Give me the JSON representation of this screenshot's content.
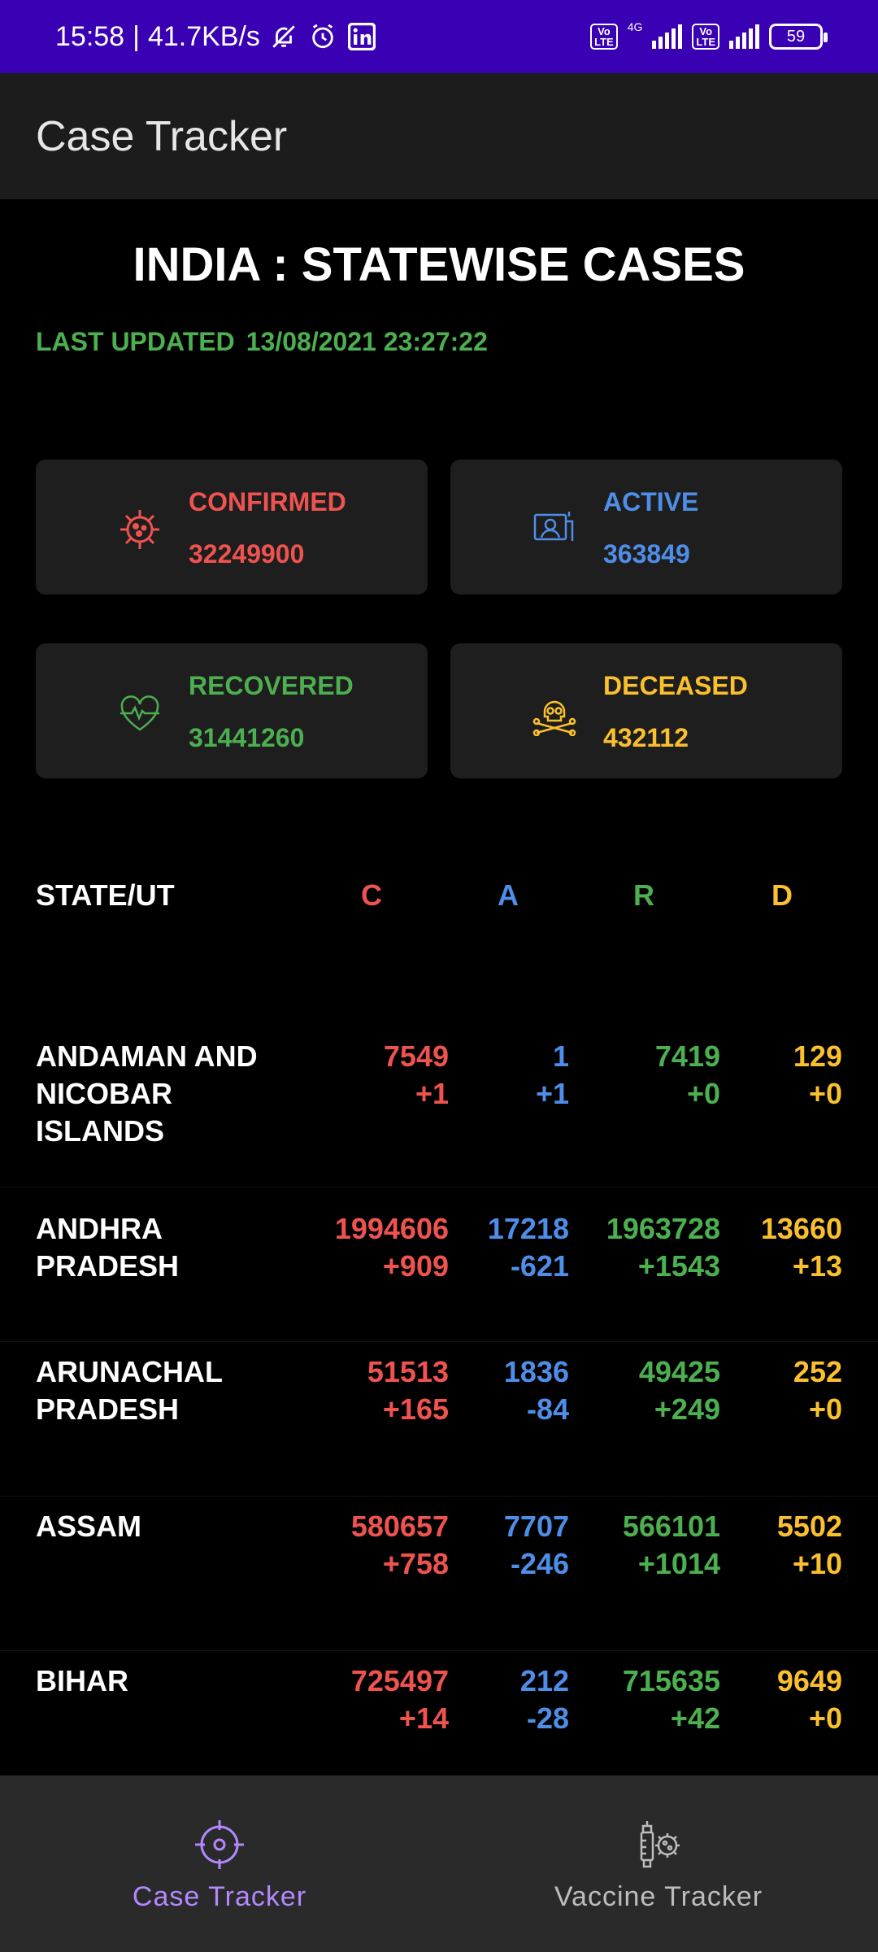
{
  "status_bar": {
    "time": "15:58",
    "network_speed": "41.7KB/s",
    "volte_label": "Vo\nLTE",
    "network_type": "4G",
    "battery": "59",
    "icons": [
      "bell-mute-icon",
      "alarm-icon",
      "linkedin-icon"
    ]
  },
  "app_bar": {
    "title": "Case Tracker"
  },
  "header": {
    "title": "INDIA : STATEWISE CASES",
    "last_updated_label": "LAST UPDATED",
    "last_updated_value": "13/08/2021 23:27:22"
  },
  "summary": {
    "confirmed": {
      "label": "CONFIRMED",
      "value": "32249900",
      "icon": "virus-icon",
      "color": "#ef5350"
    },
    "active": {
      "label": "ACTIVE",
      "value": "363849",
      "icon": "patient-monitor-icon",
      "color": "#4f8ee8"
    },
    "recovered": {
      "label": "RECOVERED",
      "value": "31441260",
      "icon": "heartbeat-icon",
      "color": "#4caf50"
    },
    "deceased": {
      "label": "DECEASED",
      "value": "432112",
      "icon": "skull-icon",
      "color": "#fbc02d"
    }
  },
  "table": {
    "headers": {
      "state": "STATE/UT",
      "c": "C",
      "a": "A",
      "r": "R",
      "d": "D"
    },
    "rows": [
      {
        "state": "ANDAMAN AND NICOBAR ISLANDS",
        "c": "7549",
        "c_delta": "+1",
        "a": "1",
        "a_delta": "+1",
        "r": "7419",
        "r_delta": "+0",
        "d": "129",
        "d_delta": "+0"
      },
      {
        "state": "ANDHRA PRADESH",
        "c": "1994606",
        "c_delta": "+909",
        "a": "17218",
        "a_delta": "-621",
        "r": "1963728",
        "r_delta": "+1543",
        "d": "13660",
        "d_delta": "+13"
      },
      {
        "state": "ARUNACHAL PRADESH",
        "c": "51513",
        "c_delta": "+165",
        "a": "1836",
        "a_delta": "-84",
        "r": "49425",
        "r_delta": "+249",
        "d": "252",
        "d_delta": "+0"
      },
      {
        "state": "ASSAM",
        "c": "580657",
        "c_delta": "+758",
        "a": "7707",
        "a_delta": "-246",
        "r": "566101",
        "r_delta": "+1014",
        "d": "5502",
        "d_delta": "+10"
      },
      {
        "state": "BIHAR",
        "c": "725497",
        "c_delta": "+14",
        "a": "212",
        "a_delta": "-28",
        "r": "715635",
        "r_delta": "+42",
        "d": "9649",
        "d_delta": "+0"
      }
    ]
  },
  "bottom_nav": {
    "items": [
      {
        "label": "Case Tracker",
        "icon": "crosshair-icon",
        "active": true
      },
      {
        "label": "Vaccine Tracker",
        "icon": "vaccine-icon",
        "active": false
      }
    ]
  },
  "colors": {
    "status_bar": "#3a00b3",
    "app_bar": "#1c1c1c",
    "accent": "#b388ff"
  }
}
